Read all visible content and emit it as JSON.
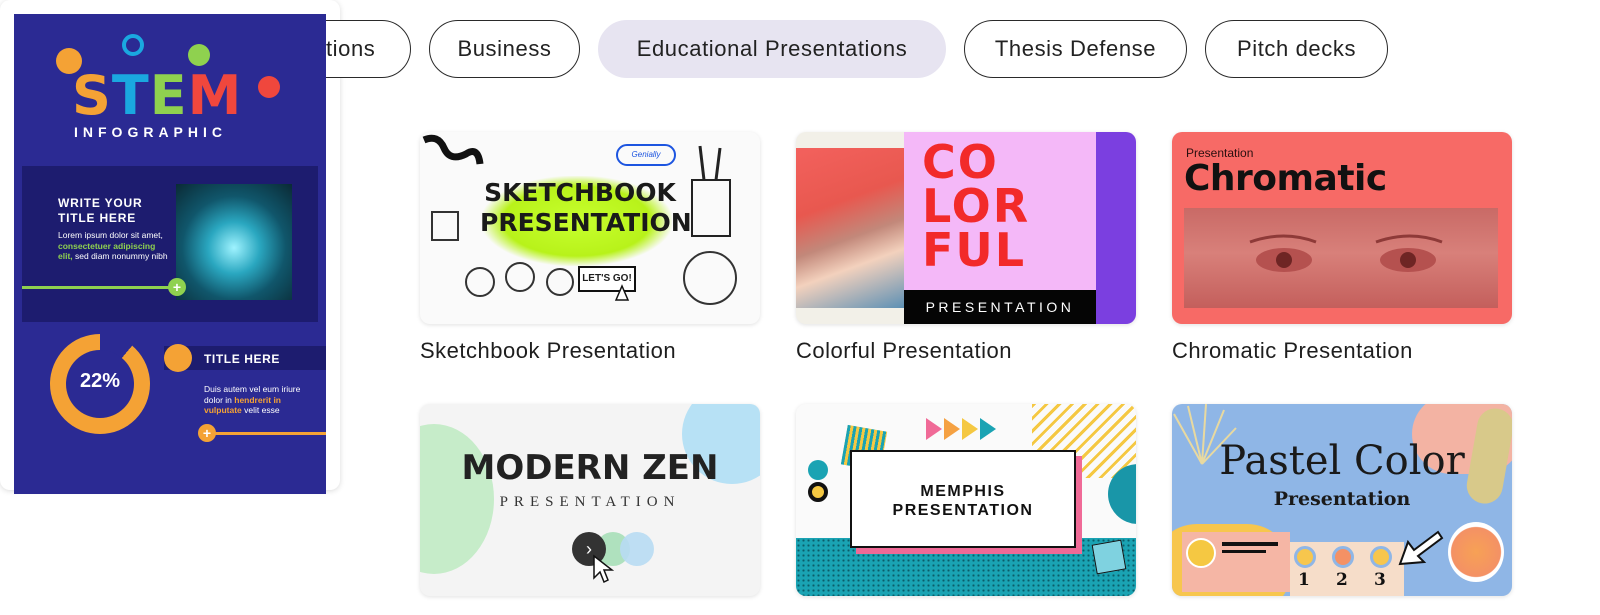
{
  "filters": {
    "chips": [
      {
        "label": "All presentations",
        "active": false
      },
      {
        "label": "Business",
        "active": false
      },
      {
        "label": "Educational Presentations",
        "active": true
      },
      {
        "label": "Thesis Defense",
        "active": false
      },
      {
        "label": "Pitch decks",
        "active": false
      }
    ]
  },
  "cards": {
    "stem": {
      "word": [
        "S",
        "T",
        "E",
        "M"
      ],
      "subtitle": "INFOGRAPHIC",
      "heading1": "WRITE YOUR TITLE HERE",
      "body1_a": "Lorem ipsum dolor sit amet, ",
      "body1_hl": "consectetuer adipiscing elit,",
      "body1_b": " sed diam nonummy nibh",
      "ring_value": "22%",
      "heading2": "TITLE HERE",
      "body2_a": "Duis autem vel eum iriure dolor in ",
      "body2_hl": "hendrerit in vulputate",
      "body2_b": " velit esse",
      "plus": "+",
      "colors": {
        "S": "#f4a235",
        "T": "#1aa8e0",
        "E": "#8fd14f",
        "M": "#f0473d"
      }
    },
    "sketchbook": {
      "thumb_title": "SKETCHBOOK PRESENTATION",
      "cloud": "Genially",
      "button": "LET'S GO!",
      "title": "Sketchbook Presentation"
    },
    "colorful": {
      "thumb_word": "CO LOR FUL",
      "thumb_sub": "PRESENTATION",
      "title": "Colorful Presentation"
    },
    "chromatic": {
      "thumb_small": "Presentation",
      "thumb_big": "Chromatic",
      "title": "Chromatic Presentation"
    },
    "modern_zen": {
      "thumb_title": "MODERN ZEN",
      "thumb_sub": "PRESENTATION",
      "arrow": "›"
    },
    "memphis": {
      "thumb_title": "MEMPHIS PRESENTATION"
    },
    "pastel": {
      "thumb_title": "Pastel Color",
      "thumb_sub": "Presentation",
      "numbers": [
        "1",
        "2",
        "3"
      ]
    }
  }
}
